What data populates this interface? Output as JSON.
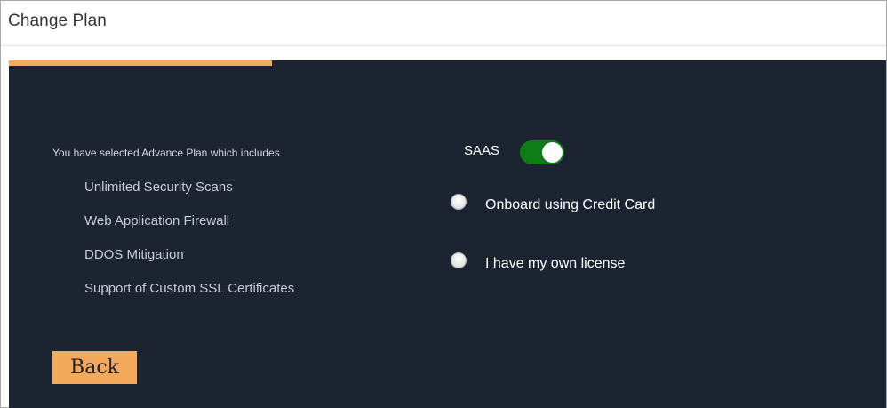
{
  "header": {
    "title": "Change Plan"
  },
  "progress": {
    "value": 0.3,
    "color": "#f5a95a"
  },
  "plan": {
    "intro": "You have selected Advance Plan which includes",
    "features": [
      "Unlimited Security Scans",
      "Web Application Firewall",
      "DDOS Mitigation",
      "Support of Custom SSL Certificates"
    ]
  },
  "saas": {
    "label": "SAAS",
    "enabled": true,
    "toggle_color": "#0e7d16"
  },
  "options": [
    {
      "label": "Onboard using Credit Card",
      "selected": false
    },
    {
      "label": "I have my own license",
      "selected": false
    }
  ],
  "actions": {
    "back_label": "Back"
  },
  "colors": {
    "panel_bg": "#1c2431",
    "accent": "#f5a95a"
  }
}
